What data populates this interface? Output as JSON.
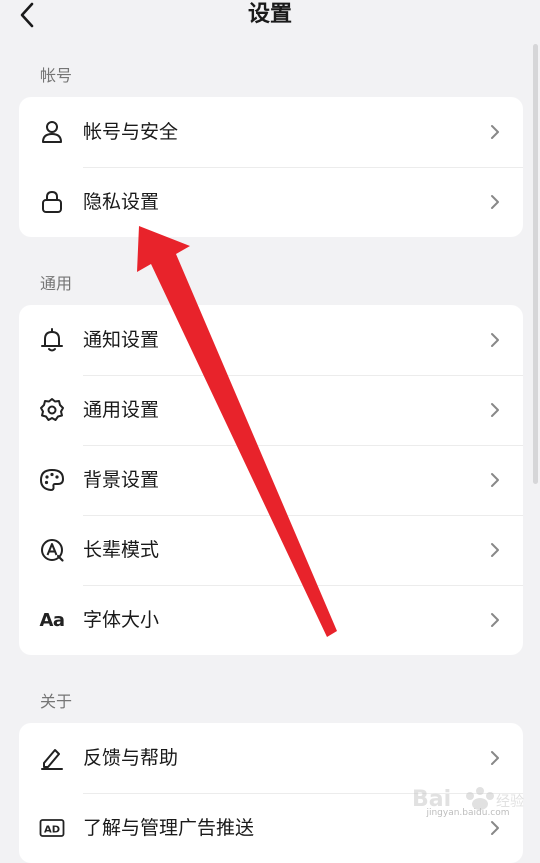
{
  "header": {
    "title": "设置"
  },
  "sections": [
    {
      "label": "帐号",
      "items": [
        {
          "label": "帐号与安全",
          "icon": "user-icon"
        },
        {
          "label": "隐私设置",
          "icon": "lock-icon"
        }
      ]
    },
    {
      "label": "通用",
      "items": [
        {
          "label": "通知设置",
          "icon": "bell-icon"
        },
        {
          "label": "通用设置",
          "icon": "gear-icon"
        },
        {
          "label": "背景设置",
          "icon": "palette-icon"
        },
        {
          "label": "长辈模式",
          "icon": "elder-mode-icon"
        },
        {
          "label": "字体大小",
          "icon": "font-size-icon",
          "icon_text": "Aa"
        }
      ]
    },
    {
      "label": "关于",
      "items": [
        {
          "label": "反馈与帮助",
          "icon": "pen-icon"
        },
        {
          "label": "了解与管理广告推送",
          "icon": "ad-icon",
          "icon_text": "AD"
        }
      ]
    }
  ],
  "annotation": {
    "arrow_color": "#e8232b"
  },
  "watermark": {
    "text": "jingyan.baidu.com"
  }
}
